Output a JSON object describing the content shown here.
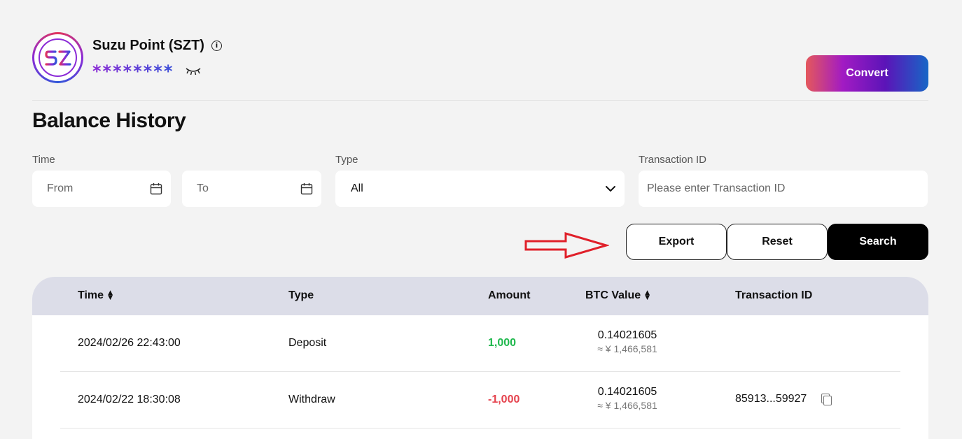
{
  "token": {
    "logo_text": "SZ",
    "name": "Suzu Point (SZT)",
    "masked_balance": "********",
    "brand_gradient": [
      "#e4585c",
      "#a21bc3",
      "#5b14b8",
      "#1766c6"
    ]
  },
  "actions": {
    "convert_label": "Convert"
  },
  "page": {
    "title": "Balance History"
  },
  "filters": {
    "time_label": "Time",
    "from_placeholder": "From",
    "to_placeholder": "To",
    "type_label": "Type",
    "type_value": "All",
    "txid_label": "Transaction ID",
    "txid_placeholder": "Please enter Transaction ID"
  },
  "buttons": {
    "export": "Export",
    "reset": "Reset",
    "search": "Search"
  },
  "table": {
    "columns": [
      "Time",
      "Type",
      "Amount",
      "BTC Value",
      "Transaction ID"
    ],
    "rows": [
      {
        "time": "2024/02/26 22:43:00",
        "type": "Deposit",
        "amount": "1,000",
        "btc": "0.14021605",
        "btc_approx": "≈ ¥ 1,466,581",
        "txid": ""
      },
      {
        "time": "2024/02/22 18:30:08",
        "type": "Withdraw",
        "amount": "-1,000",
        "btc": "0.14021605",
        "btc_approx": "≈ ¥ 1,466,581",
        "txid": "85913...59927"
      }
    ]
  },
  "colors": {
    "positive": "#1fb84d",
    "negative": "#e5424d",
    "annotation_arrow": "#e0202a"
  }
}
